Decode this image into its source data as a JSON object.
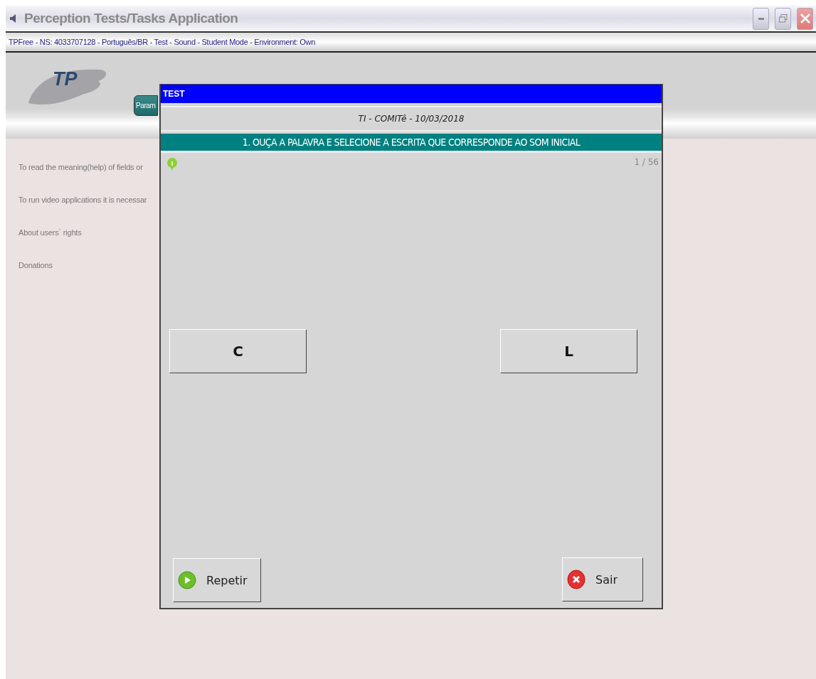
{
  "window": {
    "title": "Perception Tests/Tasks Application"
  },
  "info_bar": "TPFree - NS: 4033707128 - Português/BR - Test - Sound - Student Mode - Environment: Own",
  "header": {
    "logo": "TP",
    "tab": "Param"
  },
  "links": [
    "To read the meaning(help) of fields or",
    "To run video applications it is necessar",
    "About users´ rights",
    "Donations"
  ],
  "dialog": {
    "title": "TEST",
    "subtitle": "TI - COMITê - 10/03/2018",
    "question": "1. OUÇA A PALAVRA E SELECIONE A ESCRITA QUE CORRESPONDE AO SOM INICIAL",
    "counter": "1 / 56",
    "options": [
      "C",
      "L"
    ],
    "actions": [
      {
        "kind": "play",
        "label": "Repetir"
      },
      {
        "kind": "exit",
        "label": "Sair"
      }
    ]
  }
}
